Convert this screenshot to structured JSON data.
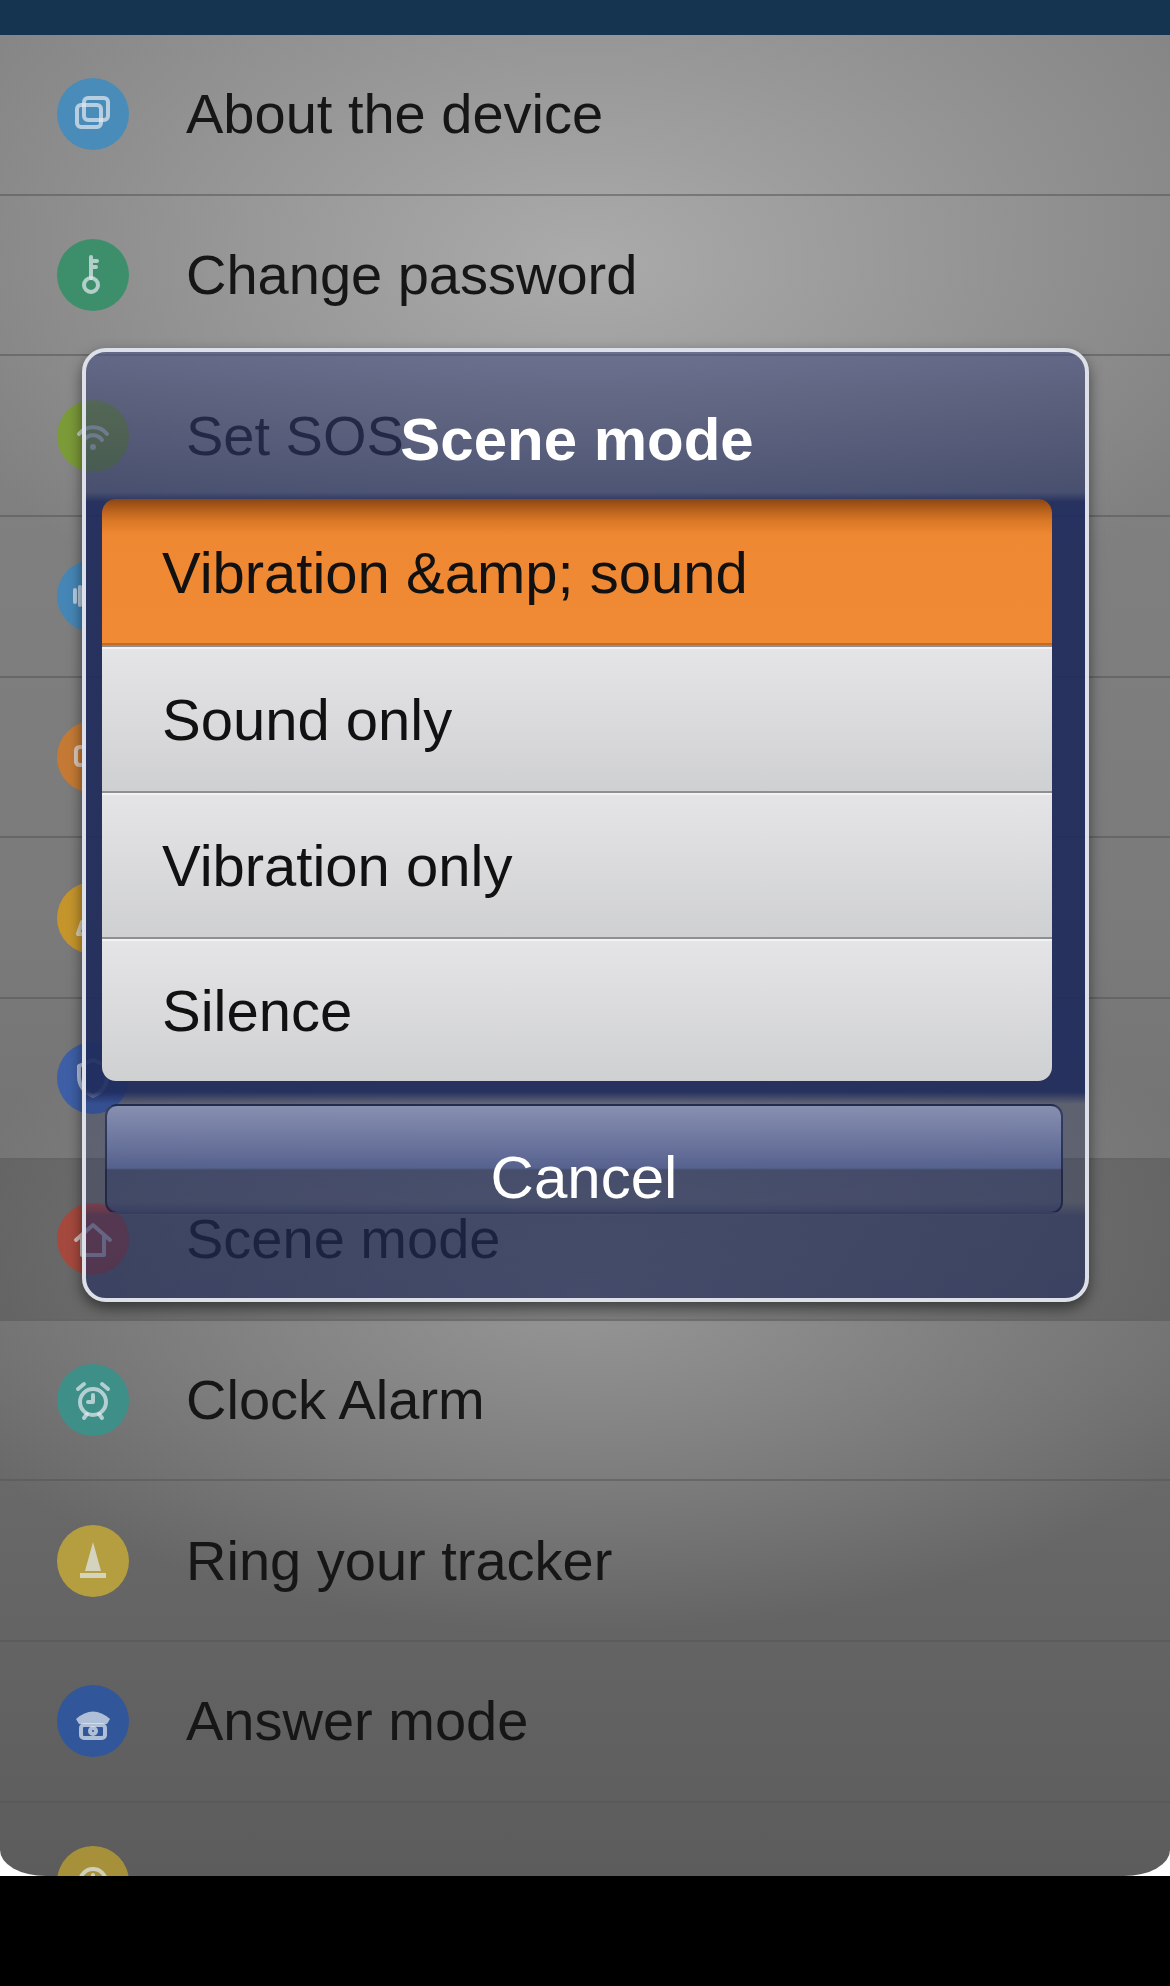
{
  "settings_list": {
    "items": [
      {
        "label": "About the device",
        "color": "#4a8cb9",
        "selected": false
      },
      {
        "label": "Change password",
        "color": "#3d8f6b",
        "selected": false
      },
      {
        "label": "Set SOS",
        "color": "#7b9a38",
        "selected": false
      },
      {
        "color": "#4586b6",
        "selected": false
      },
      {
        "color": "#c47a35",
        "selected": false
      },
      {
        "color": "#c5952c",
        "selected": false
      },
      {
        "color": "#3e5fa6",
        "selected": false
      },
      {
        "label": "Scene mode",
        "color": "#a5493e",
        "selected": true
      },
      {
        "label": "Clock Alarm",
        "color": "#3f8f89",
        "selected": false
      },
      {
        "label": "Ring your tracker",
        "color": "#b59e40",
        "selected": false
      },
      {
        "label": "Answer mode",
        "color": "#31569a",
        "selected": false
      },
      {
        "color": "#a6913a",
        "selected": false
      }
    ]
  },
  "dialog": {
    "title": "Scene mode",
    "options": [
      {
        "label": "Vibration &amp; sound",
        "selected": true
      },
      {
        "label": "Sound only",
        "selected": false
      },
      {
        "label": "Vibration only",
        "selected": false
      },
      {
        "label": "Silence",
        "selected": false
      }
    ],
    "cancel_button": "Cancel"
  }
}
